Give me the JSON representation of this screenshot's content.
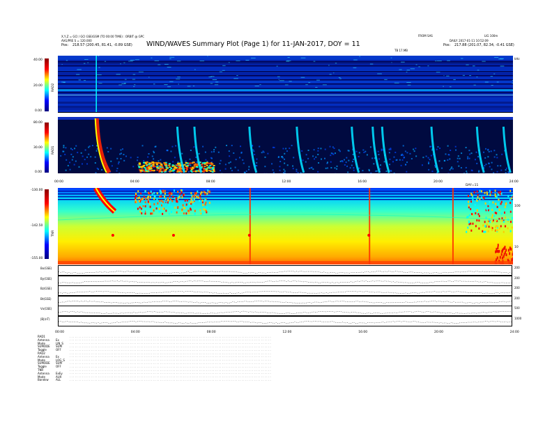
{
  "header": {
    "title": "WIND/WAVES Summary Plot (Page 1) for 11-JAN-2017, DOY = 11",
    "top_left_line1": "X,Y,Z = GCI / GCI GSE/GSM (TO 00:00 TIME) : ORBIT @ GPC",
    "top_left_line2": "AVG/PRE S = 120.000",
    "pos_left_label": "Pos:",
    "pos_left_value": "218.57 (200.45, 81.41, -0.89 GSE)",
    "top_mid_right1": "FROM SAS",
    "top_right1": "LIG 100m",
    "top_right2": "DAILY: 2017-01-11 10:52:09",
    "pos_right_label": "Pos:",
    "pos_right_value": "217.88 (201.07, 82.34, -0.41 GSE)",
    "sub_center": "TB 17.MB",
    "right_freq": "kHz"
  },
  "panels": {
    "rad2": {
      "name": "RAD2",
      "ticks": [
        "40.00",
        "20.00",
        "0.00"
      ]
    },
    "rad1": {
      "name": "RAD1",
      "ticks": [
        "80.00",
        "30.00",
        "0.00"
      ]
    },
    "tnr": {
      "name": "TNR",
      "ticks": [
        "-130.00",
        "-142.50",
        "-155.00"
      ],
      "right_ticks": [
        "100",
        "10"
      ],
      "marker": "DAY=11"
    }
  },
  "time_ticks": [
    "00:00",
    "04:00",
    "08:00",
    "12:00",
    "16:00",
    "20:00",
    "24:00"
  ],
  "time_ticks_bottom": [
    "00:00",
    "04:00",
    "08:00",
    "12:00",
    "16:00",
    "20:00",
    "24:00"
  ],
  "overview": [
    {
      "label": "Bx(GSE)",
      "right": "200"
    },
    {
      "label": "By(GSE)",
      "right": "200"
    },
    {
      "label": "Bz(GSE)",
      "right": "200"
    },
    {
      "label": "Bt(GSE)",
      "right": "200"
    },
    {
      "label": "Vx(GSE)",
      "right": "500"
    },
    {
      "label": "|B|(nT)",
      "right": "1000"
    }
  ],
  "status_rows": [
    {
      "k": "RAD1",
      "v": ""
    },
    {
      "k": "Antenna",
      "v": "Ex"
    },
    {
      "k": "Mode",
      "v": "LIN_S"
    },
    {
      "k": "SUMODE",
      "v": "SUM"
    },
    {
      "k": "Toggle",
      "v": "OFF"
    },
    {
      "k": "RAD2",
      "v": ""
    },
    {
      "k": "Antenna",
      "v": "Ex"
    },
    {
      "k": "Mode",
      "v": "LOG_S"
    },
    {
      "k": "SUMODE",
      "v": "SUM"
    },
    {
      "k": "Toggle",
      "v": "OFF"
    },
    {
      "k": "TNR",
      "v": ""
    },
    {
      "k": "Antenna",
      "v": "ExEy"
    },
    {
      "k": "Mode",
      "v": "AUX"
    },
    {
      "k": "Bandsw",
      "v": "ALL"
    }
  ],
  "chart_data": {
    "type": "heatmap",
    "title": "WIND/WAVES Summary Plot (Page 1) for 11-JAN-2017, DOY = 11",
    "x_range": [
      "00:00",
      "24:00"
    ],
    "series": [
      {
        "name": "RAD2",
        "y_range": [
          0,
          40
        ],
        "ticks": [
          0,
          20,
          40
        ]
      },
      {
        "name": "RAD1",
        "y_range": [
          0,
          80
        ],
        "ticks": [
          0,
          30,
          80
        ]
      },
      {
        "name": "TNR",
        "y_range": [
          -155,
          -130
        ],
        "ticks": [
          -155,
          -142.5,
          -130
        ]
      }
    ],
    "burst_times_hours": [
      2.0,
      6.2,
      10.0,
      12.5,
      15.5,
      16.5,
      19.8,
      22.0,
      23.5
    ],
    "colorscale": [
      "#000080",
      "#0000ff",
      "#00ffff",
      "#ffff00",
      "#ff0000"
    ]
  }
}
